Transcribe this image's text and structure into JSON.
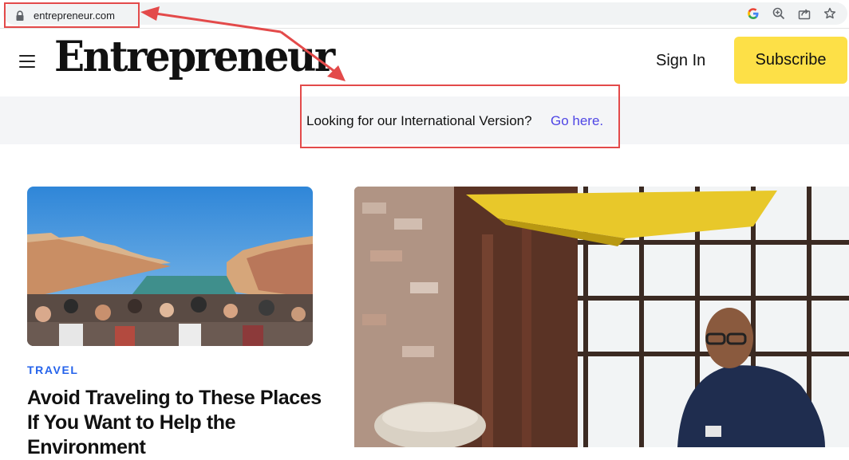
{
  "browser": {
    "url": "entrepreneur.com",
    "icons": [
      "lock-icon",
      "google-icon",
      "zoom-icon",
      "share-icon",
      "bookmark-star-icon"
    ]
  },
  "header": {
    "logo": "Entrepreneur",
    "sign_in": "Sign In",
    "subscribe": "Subscribe",
    "menu_icon": "hamburger-menu-icon"
  },
  "banner": {
    "text": "Looking for our International Version?",
    "link": "Go here."
  },
  "articles": [
    {
      "category": "TRAVEL",
      "headline": "Avoid Traveling to These Places If You Want to Help the Environment"
    }
  ],
  "colors": {
    "accent_yellow": "#fde047",
    "link_blue": "#4f46e5",
    "category_blue": "#2563eb",
    "annotation_red": "#e34a4a"
  }
}
